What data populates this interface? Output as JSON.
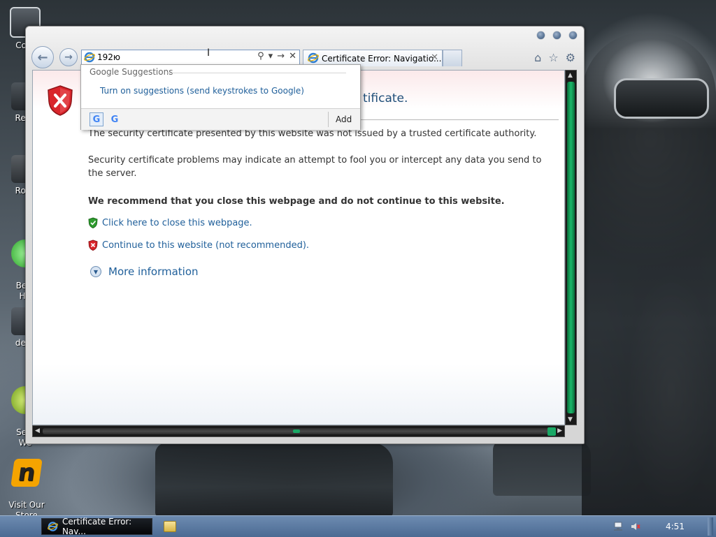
{
  "window": {
    "address_value": "192ю",
    "tab_title": "Certificate Error: Navigatio...",
    "tab_close": "✕"
  },
  "suggestions": {
    "header": "Google Suggestions",
    "item": "Turn on suggestions (send keystrokes to Google)",
    "add_label": "Add",
    "providers": [
      "G",
      "G"
    ]
  },
  "page": {
    "title_visible": "tificate.",
    "para1": "The security certificate presented by this website was not issued by a trusted certificate authority.",
    "para2": "Security certificate problems may indicate an attempt to fool you or intercept any data you send to the server.",
    "recommend": "We recommend that you close this webpage and do not continue to this website.",
    "link_close": "Click here to close this webpage.",
    "link_continue": "Continue to this website (not recommended).",
    "more_info": "More information"
  },
  "desktop": {
    "icons": [
      {
        "label": "Com"
      },
      {
        "label": "Recy"
      },
      {
        "label": "Rock"
      },
      {
        "label": "Best\nHit"
      },
      {
        "label": "desk"
      },
      {
        "label": "Sele\nWe"
      },
      {
        "label": "Visit Our\nStore"
      }
    ]
  },
  "taskbar": {
    "active_task": "Certificate Error: Nav...",
    "clock": "4:51"
  },
  "colors": {
    "link": "#1f5f9a",
    "title_blue": "#1f4e79",
    "error_red": "#d9252b",
    "taskbar": "#4b6a93",
    "scroll_green": "#1bb86a"
  }
}
